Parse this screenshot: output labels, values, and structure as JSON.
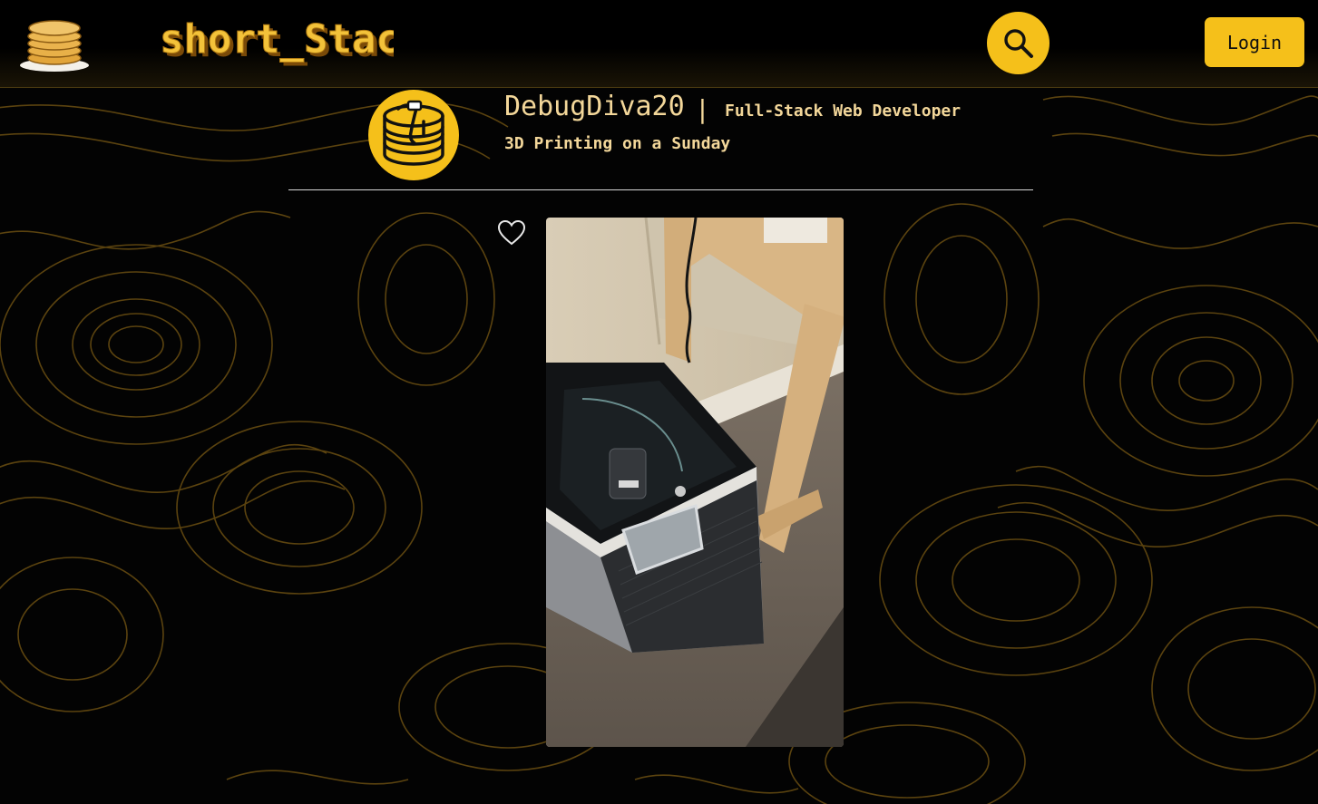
{
  "header": {
    "brand_name": "short_Stack",
    "login_label": "Login",
    "search_icon": "magnifier-icon",
    "logo_icon": "pancake-stack-icon"
  },
  "profile": {
    "username": "DebugDiva20",
    "separator": "|",
    "role": "Full-Stack Web Developer",
    "avatar_icon": "pancake-syrup-avatar"
  },
  "post": {
    "title": "3D Printing on a Sunday",
    "like_icon": "heart-outline-icon",
    "photo": "3d-printer-photo"
  },
  "colors": {
    "accent": "#f5c01a",
    "text": "#f3d79a",
    "background": "#030303",
    "contour": "#6b4f12"
  }
}
